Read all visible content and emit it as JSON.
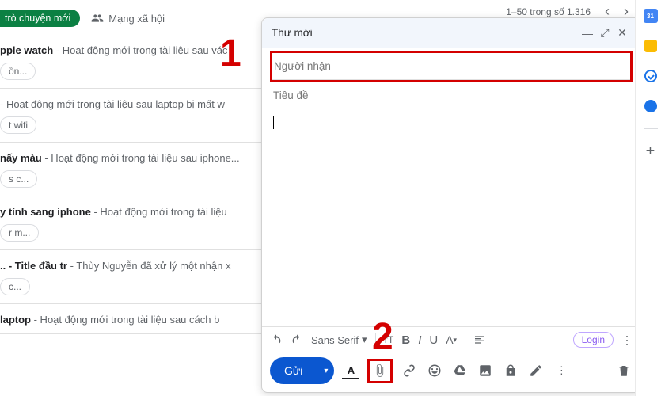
{
  "pager": {
    "range": "1–50 trong số 1.316"
  },
  "tabs": {
    "chat_pill": "trò chuyện mới",
    "social": "Mạng xã hội"
  },
  "inbox": [
    {
      "subject": "pple watch",
      "snippet": " - Hoạt động mới trong tài liệu sau vác",
      "chip": "ồn..."
    },
    {
      "subject": "",
      "snippet": " - Hoạt động mới trong tài liệu sau laptop bị mất w",
      "chip": "t wifi"
    },
    {
      "subject": "nấy màu",
      "snippet": " - Hoạt động mới trong tài liệu sau iphone...",
      "chip": "s c..."
    },
    {
      "subject": "y tính sang iphone",
      "snippet": " - Hoạt động mới trong tài liệu",
      "chip": "r m..."
    },
    {
      "subject": ".. - Title đầu tr",
      "snippet": " - Thùy Nguyễn đã xử lý một nhận x",
      "chip": " c..."
    },
    {
      "subject": "laptop",
      "snippet": " - Hoạt động mới trong tài liệu sau cách b",
      "chip": ""
    }
  ],
  "compose": {
    "title": "Thư mới",
    "recipients_placeholder": "Người nhận",
    "subject_placeholder": "Tiêu đề",
    "font": "Sans Serif",
    "login": "Login",
    "send": "Gửi"
  },
  "annotations": {
    "one": "1",
    "two": "2"
  }
}
